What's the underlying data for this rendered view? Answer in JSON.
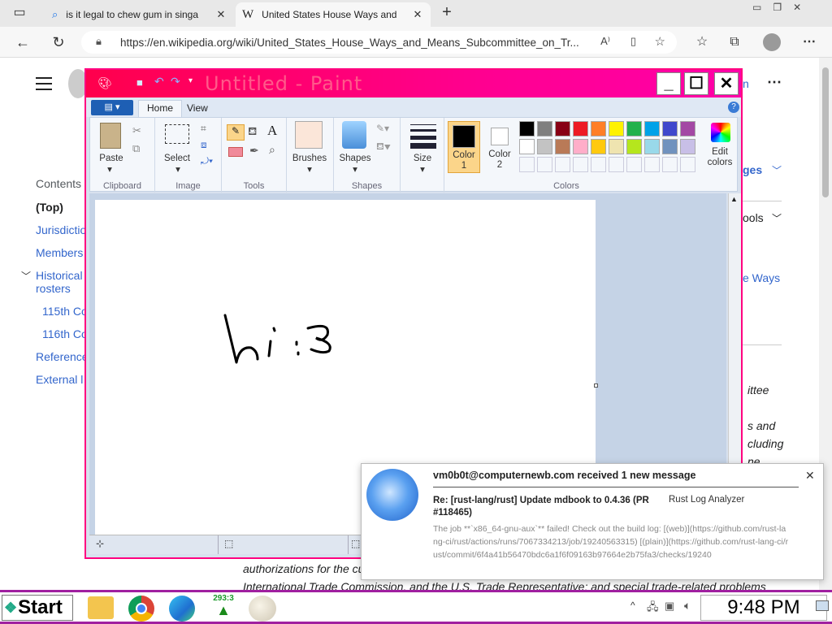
{
  "browser": {
    "tabs": [
      {
        "label": "is it legal to chew gum in singa",
        "favicon": "search-icon",
        "active": false
      },
      {
        "label": "United States House Ways and",
        "favicon": "W",
        "active": true
      }
    ],
    "new_tab_icon": "+",
    "url": "https://en.wikipedia.org/wiki/United_States_House_Ways_and_Means_Subcommittee_on_Tr..."
  },
  "wiki": {
    "contents_label": "Contents",
    "toc": [
      "(Top)",
      "Jurisdictio",
      "Members",
      "Historical",
      "rosters",
      "115th Co",
      "116th Co",
      "Reference",
      "External l"
    ],
    "right_fragments": {
      "languages": "ges",
      "tools": "ools",
      "ways": "e Ways",
      "n": "n"
    },
    "body_fragments": [
      "ittee",
      "s and",
      "cluding",
      "ne"
    ],
    "bottom_text_1": "authorizations for the cu",
    "bottom_text_2": "International Trade Commission, and the U.S. Trade Representative; and special trade-related problems"
  },
  "paint": {
    "title": "Untitled - Paint",
    "tabs": [
      "Home",
      "View"
    ],
    "groups": {
      "clipboard": {
        "label": "Clipboard",
        "paste": "Paste"
      },
      "image": {
        "label": "Image",
        "select": "Select"
      },
      "tools": {
        "label": "Tools"
      },
      "brushes": "Brushes",
      "shapes": {
        "label": "Shapes",
        "btn": "Shapes"
      },
      "size": "Size",
      "colors": {
        "label": "Colors",
        "color1": "Color\n1",
        "color2": "Color\n2",
        "edit": "Edit\ncolors"
      }
    },
    "palette_row1": [
      "#000000",
      "#7f7f7f",
      "#880015",
      "#ed1c24",
      "#ff7f27",
      "#fff200",
      "#22b14c",
      "#00a2e8",
      "#3f48cc",
      "#a349a4"
    ],
    "palette_row2": [
      "#ffffff",
      "#c3c3c3",
      "#b97a57",
      "#ffaec9",
      "#ffc90e",
      "#efe4b0",
      "#b5e61d",
      "#99d9ea",
      "#7092be",
      "#c8bfe7"
    ],
    "color1": "#000000",
    "color2": "#ffffff",
    "drawing_text": "hi :3"
  },
  "notification": {
    "sender": "vm0b0t@computernewb.com received 1 new message",
    "subject": "Re: [rust-lang/rust] Update mdbook to 0.4.36 (PR #118465)",
    "app": "Rust Log Analyzer",
    "body": "The job **`x86_64-gnu-aux`** failed! Check out the build log: [(web)](https://github.com/rust-lang-ci/rust/actions/runs/7067334213/job/19240563315) [(plain)](https://github.com/rust-lang-ci/rust/commit/6f4a41b56470bdc6a1f6f09163b97664e2b75fa3/checks/19240"
  },
  "taskbar": {
    "start_label": "Start",
    "counter": "293:3",
    "clock": "9:48 PM"
  }
}
